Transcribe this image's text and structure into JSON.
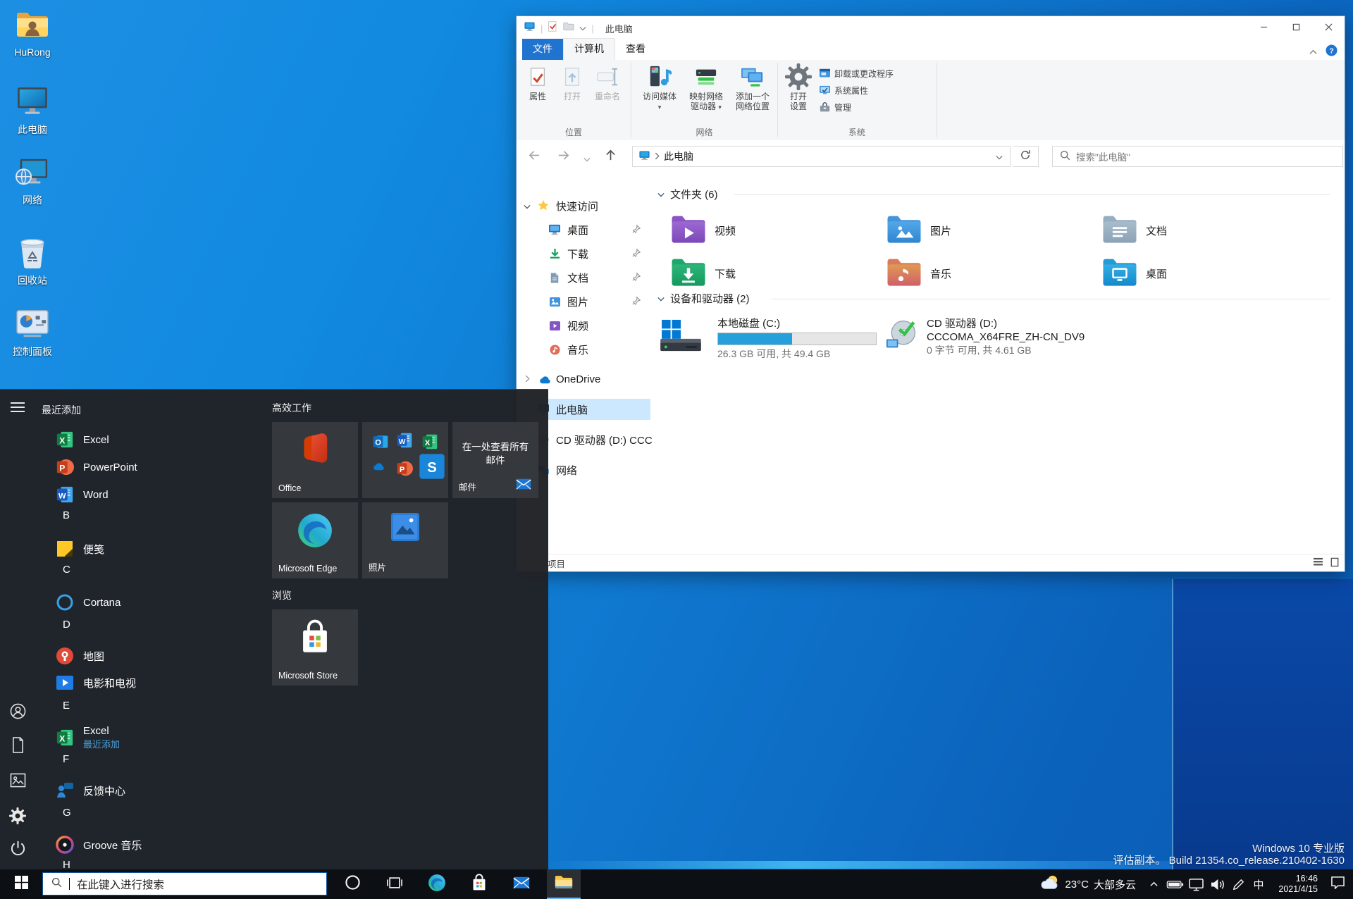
{
  "desktop": {
    "icons": [
      {
        "label": "HuRong",
        "icon": "user-folder"
      },
      {
        "label": "此电脑",
        "icon": "this-pc"
      },
      {
        "label": "网络",
        "icon": "network-pc"
      },
      {
        "label": "回收站",
        "icon": "recycle-bin"
      },
      {
        "label": "控制面板",
        "icon": "control-panel"
      }
    ],
    "watermark_line1": "Windows 10 专业版",
    "watermark_line2": "评估副本。  Build 21354.co_release.210402-1630"
  },
  "explorer": {
    "window_title": "此电脑",
    "file_tab": "文件",
    "tabs": [
      {
        "label": "计算机",
        "active": true
      },
      {
        "label": "查看",
        "active": false
      }
    ],
    "ribbon": {
      "groups": [
        {
          "label": "位置",
          "buttons": [
            {
              "lines": [
                "属性"
              ],
              "icon": "ri-properties",
              "enabled": true
            },
            {
              "lines": [
                "打开"
              ],
              "icon": "ri-open",
              "enabled": false
            },
            {
              "lines": [
                "重命名"
              ],
              "icon": "ri-rename",
              "enabled": false
            }
          ]
        },
        {
          "label": "网络",
          "buttons": [
            {
              "lines": [
                "访问媒体"
              ],
              "icon": "ri-media",
              "dropdown_below": true
            },
            {
              "lines": [
                "映射网络",
                "驱动器"
              ],
              "icon": "ri-mapdrive",
              "dropdown_inline": true
            },
            {
              "lines": [
                "添加一个",
                "网络位置"
              ],
              "icon": "ri-netloc"
            }
          ]
        },
        {
          "label": "系统",
          "big_button": {
            "lines": [
              "打开",
              "设置"
            ],
            "icon": "ri-gear"
          },
          "small_buttons": [
            {
              "label": "卸载或更改程序",
              "icon": "ri-uninstall"
            },
            {
              "label": "系统属性",
              "icon": "ri-sysprop"
            },
            {
              "label": "管理",
              "icon": "ri-manage"
            }
          ]
        }
      ]
    },
    "nav": {
      "path": "此电脑",
      "search_placeholder": "搜索\"此电脑\""
    },
    "sidebar": [
      {
        "label": "快速访问",
        "icon": "star",
        "chevron": "down"
      },
      {
        "label": "桌面",
        "icon": "sb-desktop",
        "pin": true,
        "child": true
      },
      {
        "label": "下载",
        "icon": "sb-downloads",
        "pin": true,
        "child": true
      },
      {
        "label": "文档",
        "icon": "sb-documents",
        "pin": true,
        "child": true
      },
      {
        "label": "图片",
        "icon": "sb-pictures",
        "pin": true,
        "child": true
      },
      {
        "label": "视频",
        "icon": "sb-videos",
        "child": true
      },
      {
        "label": "音乐",
        "icon": "sb-music",
        "child": true
      },
      {
        "label": "OneDrive",
        "icon": "onedrive",
        "chevron": "right"
      },
      {
        "label": "此电脑",
        "icon": "sb-pc",
        "selected": true
      },
      {
        "label": "CD 驱动器 (D:) CCC",
        "icon": "sb-cd"
      },
      {
        "label": "网络",
        "icon": "sb-network"
      }
    ],
    "folders_header": "文件夹 (6)",
    "folders": [
      {
        "label": "视频",
        "c1": "#9c68d3",
        "c2": "#7c48b8",
        "tab": "#8a54c4",
        "glyph": "play"
      },
      {
        "label": "图片",
        "c1": "#53a7e8",
        "c2": "#2f86d0",
        "tab": "#4295dc",
        "glyph": "image"
      },
      {
        "label": "文档",
        "c1": "#a8bccc",
        "c2": "#8ba2b5",
        "tab": "#97aec0",
        "glyph": "lines"
      },
      {
        "label": "下载",
        "c1": "#2eb579",
        "c2": "#13995e",
        "tab": "#1fa76b",
        "glyph": "down"
      },
      {
        "label": "音乐",
        "c1": "#e09a52",
        "c2": "#cf5f6a",
        "tab": "#d87a5e",
        "glyph": "note"
      },
      {
        "label": "桌面",
        "c1": "#35aee5",
        "c2": "#1389cd",
        "tab": "#249bd9",
        "glyph": "screen"
      }
    ],
    "devices_header": "设备和驱动器 (2)",
    "drives": [
      {
        "name": "本地磁盘 (C:)",
        "info": "26.3 GB 可用, 共 49.4 GB",
        "fill_percent": 47,
        "icon": "hdd"
      },
      {
        "name": "CD 驱动器 (D:)",
        "name2": "CCCOMA_X64FRE_ZH-CN_DV9",
        "info": "0 字节 可用, 共 4.61 GB",
        "icon": "cd"
      }
    ],
    "status_items_text": "项目"
  },
  "start_menu": {
    "rail": [
      {
        "name": "menu",
        "icon": "hamburger"
      },
      {
        "name": "account",
        "icon": "user-outline"
      },
      {
        "name": "documents",
        "icon": "doc-outline"
      },
      {
        "name": "pictures",
        "icon": "pic-outline"
      },
      {
        "name": "settings",
        "icon": "gear-outline"
      },
      {
        "name": "power",
        "icon": "power"
      }
    ],
    "list": [
      {
        "type": "header",
        "label": "最近添加"
      },
      {
        "type": "app",
        "label": "Excel",
        "icon": "excel"
      },
      {
        "type": "app",
        "label": "PowerPoint",
        "icon": "powerpoint"
      },
      {
        "type": "app",
        "label": "Word",
        "icon": "word"
      },
      {
        "type": "letter",
        "label": "B"
      },
      {
        "type": "app",
        "label": "便笺",
        "icon": "sticky-notes"
      },
      {
        "type": "letter",
        "label": "C"
      },
      {
        "type": "app",
        "label": "Cortana",
        "icon": "cortana"
      },
      {
        "type": "letter",
        "label": "D"
      },
      {
        "type": "app",
        "label": "地图",
        "icon": "maps"
      },
      {
        "type": "app",
        "label": "电影和电视",
        "icon": "movies-tv"
      },
      {
        "type": "letter",
        "label": "E"
      },
      {
        "type": "app",
        "label": "Excel",
        "sub": "最近添加",
        "icon": "excel"
      },
      {
        "type": "letter",
        "label": "F"
      },
      {
        "type": "app",
        "label": "反馈中心",
        "icon": "feedback-hub"
      },
      {
        "type": "letter",
        "label": "G"
      },
      {
        "type": "app",
        "label": "Groove 音乐",
        "icon": "groove"
      },
      {
        "type": "letter",
        "label": "H"
      }
    ],
    "group_headers": [
      "高效工作",
      "浏览"
    ],
    "tiles": [
      {
        "label": "Office",
        "icon": "office",
        "kind": "icon-label"
      },
      {
        "label": "",
        "icon": "office-apps",
        "kind": "apps-grid"
      },
      {
        "text": "在一处查看所有邮件",
        "label": "邮件",
        "icon": "mail-envelope",
        "kind": "mail"
      },
      {
        "label": "Microsoft Edge",
        "icon": "edge",
        "kind": "icon-label"
      },
      {
        "label": "照片",
        "icon": "photos",
        "kind": "icon-label"
      },
      {
        "label": "Microsoft Store",
        "icon": "store-bag",
        "kind": "icon-label"
      }
    ]
  },
  "taskbar": {
    "search_placeholder": "在此键入进行搜索",
    "buttons": [
      {
        "name": "cortana",
        "icon": "cortana-ring"
      },
      {
        "name": "task-view",
        "icon": "task-view"
      },
      {
        "name": "edge",
        "icon": "edge"
      },
      {
        "name": "store",
        "icon": "store-bag"
      },
      {
        "name": "mail",
        "icon": "mail-envelope"
      },
      {
        "name": "file-explorer",
        "icon": "explorer-folder",
        "active": true
      }
    ],
    "tray": {
      "weather_temp": "23°C",
      "weather_text": "大部多云",
      "ime": "中",
      "time": "16:46",
      "date": "2021/4/15"
    }
  }
}
